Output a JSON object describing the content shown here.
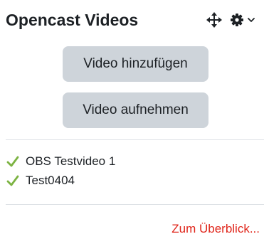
{
  "block": {
    "title": "Opencast Videos",
    "controls": {
      "move_icon": "move-icon",
      "gear_icon": "gear-icon",
      "chevron_icon": "chevron-down-icon"
    }
  },
  "actions": {
    "add_video_label": "Video hinzufügen",
    "record_video_label": "Video aufnehmen"
  },
  "videos": [
    {
      "title": "OBS Testvideo 1",
      "status_icon": "check-icon"
    },
    {
      "title": "Test0404",
      "status_icon": "check-icon"
    }
  ],
  "footer": {
    "overview_link": "Zum Überblick..."
  },
  "colors": {
    "button_bg": "#ced4da",
    "check_green": "#7cb342",
    "link_red": "#e0261b",
    "text": "#1d2125",
    "divider": "#dee2e6"
  }
}
